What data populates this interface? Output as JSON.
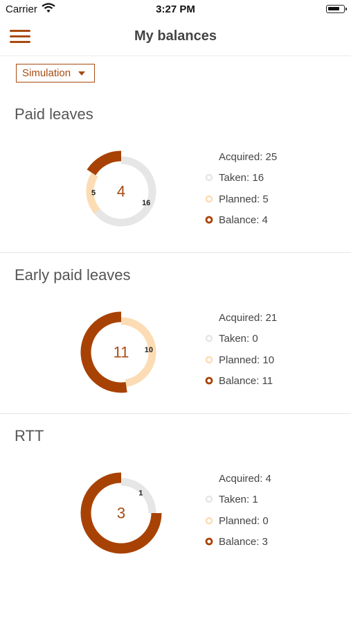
{
  "status_bar": {
    "carrier": "Carrier",
    "time": "3:27 PM"
  },
  "header": {
    "title": "My balances"
  },
  "simulation": {
    "label": "Simulation"
  },
  "colors": {
    "taken": "#e6e6e6",
    "planned": "#fcdcb4",
    "balance": "#a84204",
    "accent": "#a84a10"
  },
  "sections": [
    {
      "title": "Paid leaves",
      "chart_data": {
        "type": "donut",
        "center_value": "4",
        "segments": [
          {
            "name": "Taken",
            "value": 16,
            "label": "16"
          },
          {
            "name": "Planned",
            "value": 5,
            "label": "5"
          },
          {
            "name": "Balance",
            "value": 4,
            "label": ""
          }
        ]
      },
      "legend": {
        "acquired": "Acquired: 25",
        "taken": "Taken: 16",
        "planned": "Planned: 5",
        "balance": "Balance: 4"
      }
    },
    {
      "title": "Early paid leaves",
      "chart_data": {
        "type": "donut",
        "center_value": "11",
        "segments": [
          {
            "name": "Taken",
            "value": 0,
            "label": ""
          },
          {
            "name": "Planned",
            "value": 10,
            "label": "10"
          },
          {
            "name": "Balance",
            "value": 11,
            "label": ""
          }
        ]
      },
      "legend": {
        "acquired": "Acquired: 21",
        "taken": "Taken: 0",
        "planned": "Planned: 10",
        "balance": "Balance: 11"
      }
    },
    {
      "title": "RTT",
      "chart_data": {
        "type": "donut",
        "center_value": "3",
        "segments": [
          {
            "name": "Taken",
            "value": 1,
            "label": "1"
          },
          {
            "name": "Planned",
            "value": 0,
            "label": ""
          },
          {
            "name": "Balance",
            "value": 3,
            "label": ""
          }
        ]
      },
      "legend": {
        "acquired": "Acquired: 4",
        "taken": "Taken: 1",
        "planned": "Planned: 0",
        "balance": "Balance: 3"
      }
    }
  ]
}
